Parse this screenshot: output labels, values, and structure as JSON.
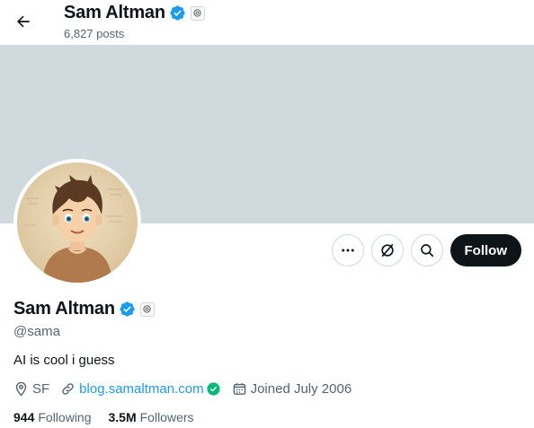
{
  "header": {
    "name": "Sam Altman",
    "posts": "6,827 posts"
  },
  "profile": {
    "name": "Sam Altman",
    "handle": "@sama",
    "bio": "AI is cool i guess",
    "location": "SF",
    "website": "blog.samaltman.com",
    "joined": "Joined July 2006",
    "following_count": "944",
    "following_label": "Following",
    "followers_count": "3.5M",
    "followers_label": "Followers"
  },
  "actions": {
    "follow_label": "Follow",
    "icons": [
      "more-icon",
      "grok-icon",
      "search-icon"
    ]
  },
  "colors": {
    "banner": "#cfd9de",
    "verified": "#1d9bf0",
    "link": "#1d9bf0",
    "follow_bg": "#0f1419",
    "secondary_text": "#536471",
    "website_check": "#00ba7c"
  }
}
